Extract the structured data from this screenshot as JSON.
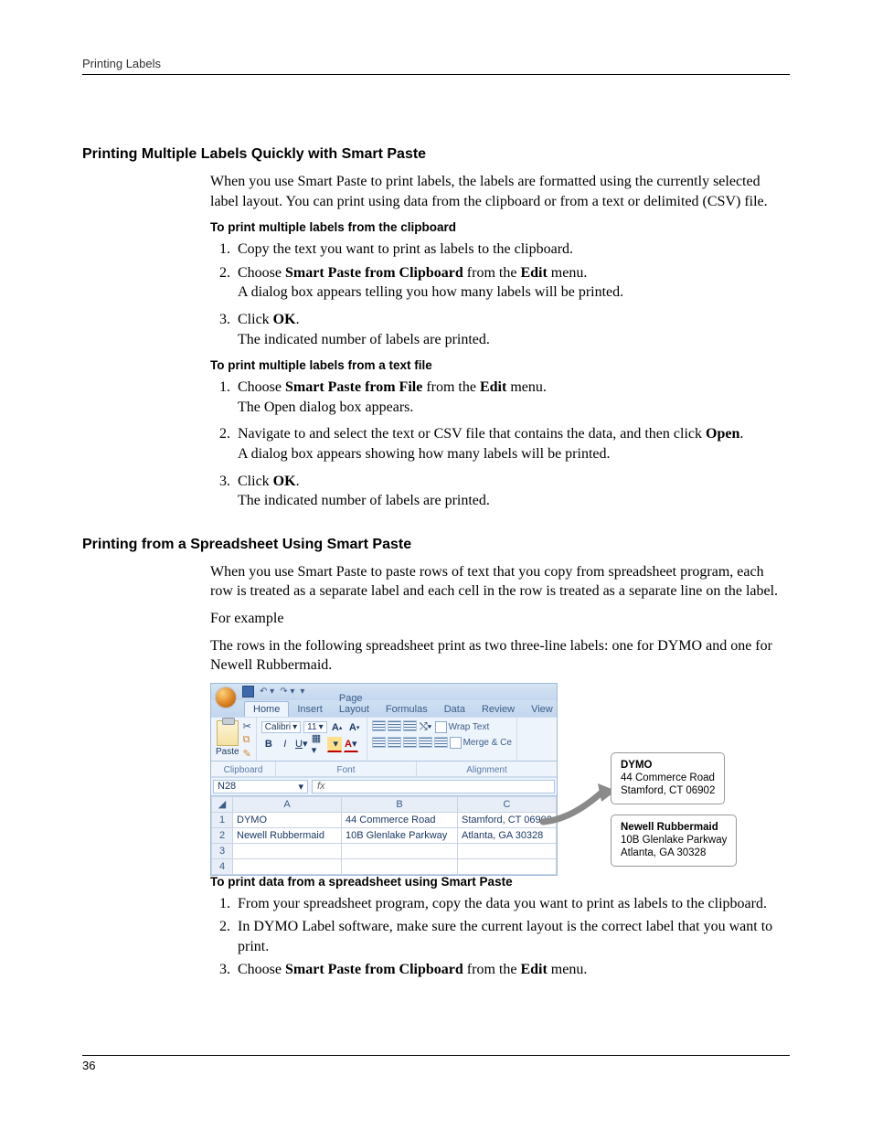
{
  "running_head": "Printing Labels",
  "page_number": "36",
  "section1": {
    "heading": "Printing Multiple Labels Quickly with Smart Paste",
    "intro": "When you use Smart Paste to print labels, the labels are formatted using the currently selected label layout. You can print using data from the clipboard or from a text or delimited (CSV) file.",
    "proc1_title": "To print multiple labels from the clipboard",
    "proc1_step1": "Copy the text you want to print as labels to the clipboard.",
    "proc1_step2_pre": "Choose ",
    "proc1_step2_b1": "Smart Paste from Clipboard",
    "proc1_step2_mid": " from the ",
    "proc1_step2_b2": "Edit",
    "proc1_step2_post": " menu.",
    "proc1_step2_follow": "A dialog box appears telling you how many labels will be printed.",
    "proc1_step3_pre": "Click ",
    "proc1_step3_b": "OK",
    "proc1_step3_post": ".",
    "proc1_step3_follow": "The indicated number of labels are printed.",
    "proc2_title": "To print multiple labels from a text file",
    "proc2_step1_pre": "Choose ",
    "proc2_step1_b1": "Smart Paste from File",
    "proc2_step1_mid": " from the ",
    "proc2_step1_b2": "Edit",
    "proc2_step1_post": " menu.",
    "proc2_step1_follow": "The Open dialog box appears.",
    "proc2_step2_pre": "Navigate to and select the text or CSV file that contains the data, and then click ",
    "proc2_step2_b": "Open",
    "proc2_step2_post": ".",
    "proc2_step2_follow": "A dialog box appears showing how many labels will be printed.",
    "proc2_step3_pre": "Click ",
    "proc2_step3_b": "OK",
    "proc2_step3_post": ".",
    "proc2_step3_follow": "The indicated number of labels are printed."
  },
  "section2": {
    "heading": "Printing from a Spreadsheet Using Smart Paste",
    "p1": "When you use Smart Paste to paste rows of text that you copy from spreadsheet program, each row is treated as a separate label and each cell in the row is treated as a separate line on the label.",
    "p2": "For example",
    "p3": "The rows in the following spreadsheet print as two three-line labels: one for DYMO and one for Newell Rubbermaid.",
    "proc_title": "To print data from a spreadsheet using Smart Paste",
    "proc_step1": "From your spreadsheet program, copy the data you want to print as labels to the clipboard.",
    "proc_step2": "In DYMO Label software, make sure the current layout is the correct label that you want to print.",
    "proc_step3_pre": "Choose ",
    "proc_step3_b1": "Smart Paste from Clipboard",
    "proc_step3_mid": " from the ",
    "proc_step3_b2": "Edit",
    "proc_step3_post": " menu."
  },
  "excel": {
    "tabs": {
      "home": "Home",
      "insert": "Insert",
      "pagelayout": "Page Layout",
      "formulas": "Formulas",
      "data": "Data",
      "review": "Review",
      "view": "View"
    },
    "font_name": "Calibri",
    "font_size": "11",
    "paste_label": "Paste",
    "grp_clipboard": "Clipboard",
    "grp_font": "Font",
    "grp_alignment": "Alignment",
    "wrap_text": "Wrap Text",
    "merge": "Merge & Ce",
    "namebox": "N28",
    "fx": "fx",
    "cols": {
      "a": "A",
      "b": "B",
      "c": "C"
    },
    "rows": {
      "r1": "1",
      "r2": "2",
      "r3": "3",
      "r4": "4"
    },
    "data": {
      "a1": "DYMO",
      "b1": "44 Commerce Road",
      "c1": "Stamford, CT 06902",
      "a2": "Newell Rubbermaid",
      "b2": "10B Glenlake Parkway",
      "c2": "Atlanta, GA 30328"
    }
  },
  "labels": {
    "l1_name": "DYMO",
    "l1_line2": "44 Commerce Road",
    "l1_line3": "Stamford, CT 06902",
    "l2_name": "Newell Rubbermaid",
    "l2_line2": "10B Glenlake Parkway",
    "l2_line3": "Atlanta, GA 30328"
  }
}
